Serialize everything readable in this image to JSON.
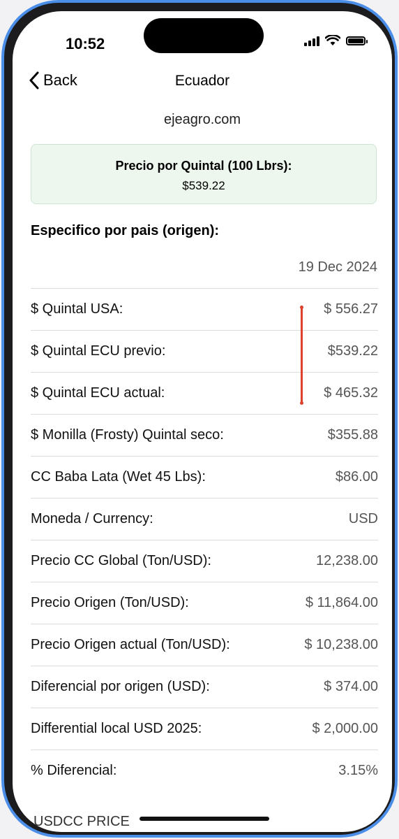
{
  "status_bar": {
    "time": "10:52"
  },
  "nav": {
    "back_label": "Back",
    "title": "Ecuador"
  },
  "site": "ejeagro.com",
  "price_box": {
    "title": "Precio por Quintal (100 Lbrs):",
    "value": "$539.22"
  },
  "section_heading": "Especifico por pais (origen):",
  "date": "19 Dec 2024",
  "rows": [
    {
      "label": "$ Quintal USA:",
      "value": "$ 556.27"
    },
    {
      "label": "$ Quintal ECU previo:",
      "value": "$539.22"
    },
    {
      "label": "$ Quintal ECU actual:",
      "value": "$ 465.32"
    },
    {
      "label": "$ Monilla (Frosty) Quintal seco:",
      "value": "$355.88"
    },
    {
      "label": "CC Baba Lata (Wet 45 Lbs):",
      "value": "$86.00"
    },
    {
      "label": "Moneda / Currency:",
      "value": "USD"
    },
    {
      "label": "Precio CC Global (Ton/USD):",
      "value": "12,238.00"
    },
    {
      "label": "Precio Origen (Ton/USD):",
      "value": "$ 11,864.00"
    },
    {
      "label": "Precio Origen actual (Ton/USD):",
      "value": "$ 10,238.00"
    },
    {
      "label": "Diferencial por origen (USD):",
      "value": "$ 374.00"
    },
    {
      "label": "Differential local USD 2025:",
      "value": "$ 2,000.00"
    },
    {
      "label": "% Diferencial:",
      "value": "3.15%"
    }
  ],
  "partial_row_label": "USDCC PRICE",
  "colors": {
    "frame": "#4b8ee8",
    "highlight_line": "#e0412c",
    "price_box_bg": "#eef7ee"
  }
}
